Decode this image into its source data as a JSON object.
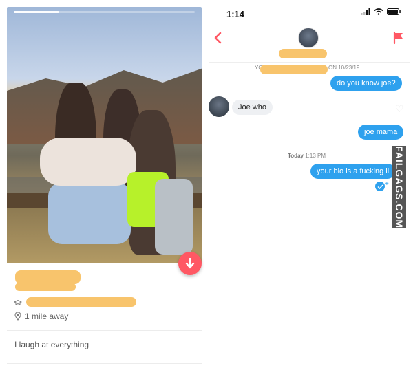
{
  "profile": {
    "distance": "1 mile away",
    "bio": "I laugh at everything",
    "photo_progress": 0.25,
    "icons": {
      "distance": "location-pin-icon",
      "school": "graduation-cap-icon",
      "collapse": "arrow-down-icon"
    }
  },
  "status_bar": {
    "time": "1:14"
  },
  "chat": {
    "match_prefix": "YO",
    "match_date": "ON 10/23/19",
    "messages": [
      {
        "from": "me",
        "text": "do you know joe?"
      },
      {
        "from": "them",
        "text": "Joe who"
      },
      {
        "from": "me",
        "text": "joe mama"
      },
      {
        "from": "me",
        "text": "your bio is a fucking li"
      }
    ],
    "timestamp_day": "Today",
    "timestamp_time": "1:13 PM"
  },
  "watermark": "FAILGAGS.COM",
  "colors": {
    "tinder_red": "#ff5864",
    "bubble_blue": "#2ea1ee",
    "redaction": "#f8c46c"
  }
}
